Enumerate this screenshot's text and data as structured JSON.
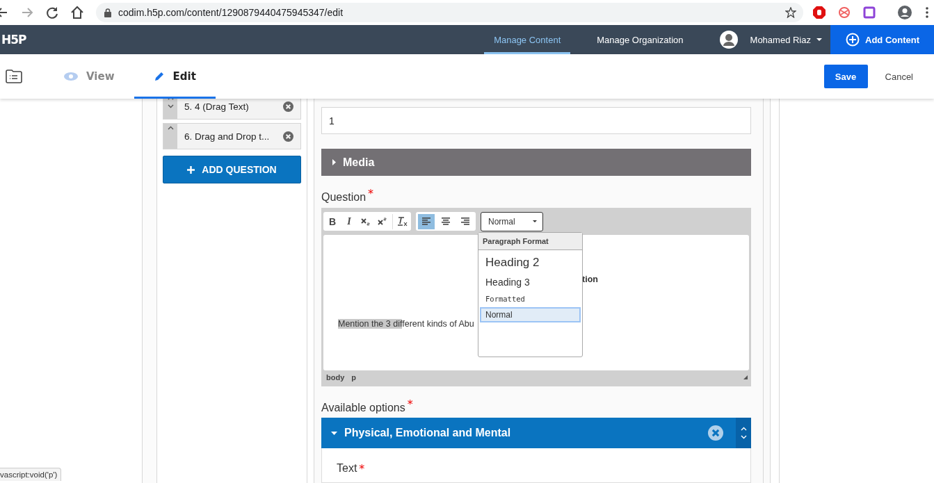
{
  "browser": {
    "url": "codim.h5p.com/content/1290879440475945347/edit"
  },
  "header": {
    "logo": "H5P",
    "nav": [
      {
        "label": "Manage Content",
        "selected": true
      },
      {
        "label": "Manage Organization",
        "selected": false
      }
    ],
    "user": "Mohamed Riaz",
    "add_button": "Add Content"
  },
  "toolbar": {
    "tabs": [
      {
        "label": "View",
        "kind": "view",
        "selected": false
      },
      {
        "label": "Edit",
        "kind": "edit",
        "selected": true
      }
    ],
    "save": "Save",
    "cancel": "Cancel"
  },
  "questions": [
    {
      "label": "5. 4 (Drag Text)",
      "can_move_down": true
    },
    {
      "label": "6. Drag and Drop t...",
      "can_move_down": false
    }
  ],
  "add_question": "ADD QUESTION",
  "form": {
    "number_value": "1",
    "media": "Media",
    "question_label": "Question",
    "editor": {
      "buttons": [
        {
          "kind": "bold",
          "label": "B"
        },
        {
          "kind": "italic",
          "label": "I"
        },
        {
          "kind": "sub"
        },
        {
          "kind": "sup"
        },
        {
          "kind": "clear"
        }
      ],
      "align": [
        {
          "kind": "left",
          "selected": true
        },
        {
          "kind": "center",
          "selected": false
        },
        {
          "kind": "right",
          "selected": false
        }
      ],
      "format": "Normal",
      "heading_fragment": "tion",
      "paragraph": {
        "selected": "Mention the 3 dif",
        "rest": "ferent kinds of Abu"
      },
      "path": [
        "body",
        "p"
      ],
      "menu": {
        "title": "Paragraph Format",
        "items": [
          {
            "label": "Heading 2",
            "kind": "h2",
            "selected": false
          },
          {
            "label": "Heading 3",
            "kind": "h3",
            "selected": false
          },
          {
            "label": "Formatted",
            "kind": "pre",
            "selected": false
          },
          {
            "label": "Normal",
            "kind": "p",
            "selected": true
          }
        ]
      }
    },
    "question_required": "*",
    "options_label": "Available options",
    "options_required": "*",
    "text_required": "*",
    "option": {
      "title": "Physical, Emotional and Mental",
      "expanded": true
    },
    "text_label": "Text"
  },
  "status_link": "vascript:void('p')"
}
